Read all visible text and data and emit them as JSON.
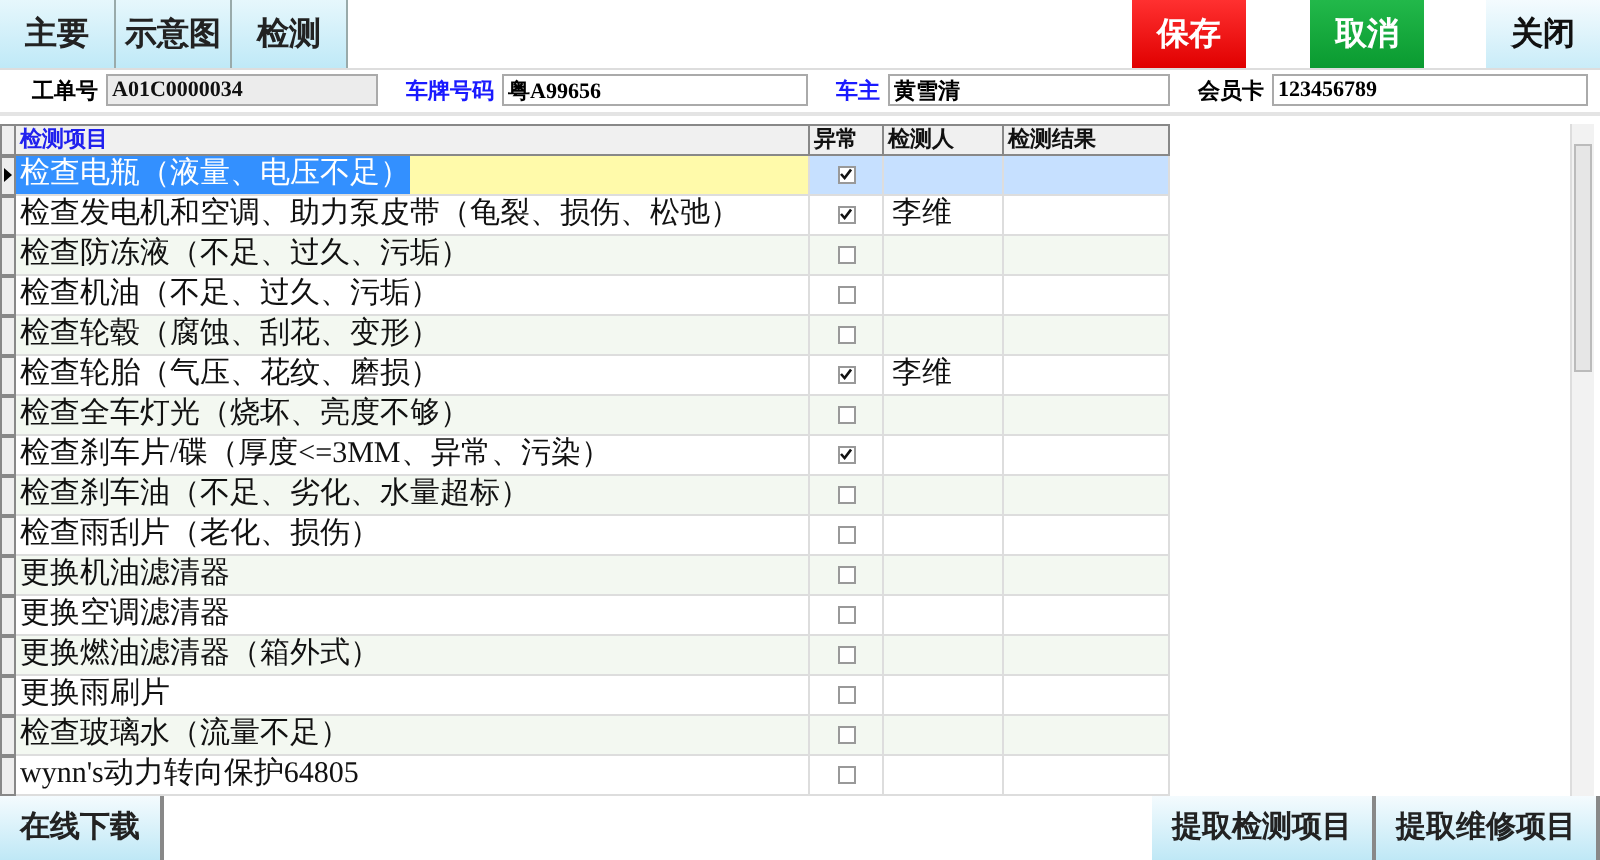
{
  "tabs": [
    {
      "label": "主要"
    },
    {
      "label": "示意图"
    },
    {
      "label": "检测"
    }
  ],
  "actions": [
    {
      "label": "保存",
      "kind": "danger"
    },
    {
      "label": "取消",
      "kind": "confirm"
    },
    {
      "label": "关闭",
      "kind": "plain"
    }
  ],
  "fields": [
    {
      "label": "工单号",
      "value": "A01C0000034",
      "color": "#000000",
      "disabled": true
    },
    {
      "label": "车牌号码",
      "value": "粤A99656",
      "color": "#1a1aff",
      "disabled": false
    },
    {
      "label": "车主",
      "value": "黄雪清",
      "color": "#1a1aff",
      "disabled": false
    },
    {
      "label": "会员卡",
      "value": "123456789",
      "color": "#000000",
      "disabled": false
    }
  ],
  "table": {
    "columns": [
      "检测项目",
      "异常",
      "检测人",
      "检测结果"
    ],
    "rows": [
      {
        "item": "检查电瓶（液量、电压不足）",
        "abnormal": true,
        "inspector": "",
        "selected": true
      },
      {
        "item": "检查发电机和空调、助力泵皮带（龟裂、损伤、松弛）",
        "abnormal": true,
        "inspector": "李维",
        "selected": false
      },
      {
        "item": "检查防冻液（不足、过久、污垢）",
        "abnormal": false,
        "inspector": "",
        "selected": false
      },
      {
        "item": "检查机油（不足、过久、污垢）",
        "abnormal": false,
        "inspector": "",
        "selected": false
      },
      {
        "item": "检查轮毂（腐蚀、刮花、变形）",
        "abnormal": false,
        "inspector": "",
        "selected": false
      },
      {
        "item": "检查轮胎（气压、花纹、磨损）",
        "abnormal": true,
        "inspector": "李维",
        "selected": false
      },
      {
        "item": "检查全车灯光（烧坏、亮度不够）",
        "abnormal": false,
        "inspector": "",
        "selected": false
      },
      {
        "item": "检查刹车片/碟（厚度<=3MM、异常、污染）",
        "abnormal": true,
        "inspector": "",
        "selected": false
      },
      {
        "item": "检查刹车油（不足、劣化、水量超标）",
        "abnormal": false,
        "inspector": "",
        "selected": false
      },
      {
        "item": "检查雨刮片（老化、损伤）",
        "abnormal": false,
        "inspector": "",
        "selected": false
      },
      {
        "item": "更换机油滤清器",
        "abnormal": false,
        "inspector": "",
        "selected": false
      },
      {
        "item": "更换空调滤清器",
        "abnormal": false,
        "inspector": "",
        "selected": false
      },
      {
        "item": "更换燃油滤清器（箱外式）",
        "abnormal": false,
        "inspector": "",
        "selected": false
      },
      {
        "item": "更换雨刷片",
        "abnormal": false,
        "inspector": "",
        "selected": false
      },
      {
        "item": "检查玻璃水（流量不足）",
        "abnormal": false,
        "inspector": "",
        "selected": false
      },
      {
        "item": "wynn's动力转向保护64805",
        "abnormal": false,
        "inspector": "",
        "selected": false
      }
    ]
  },
  "bottom_left": [
    "在线下载"
  ],
  "bottom_right": [
    "提取检测项目",
    "提取维修项目"
  ]
}
